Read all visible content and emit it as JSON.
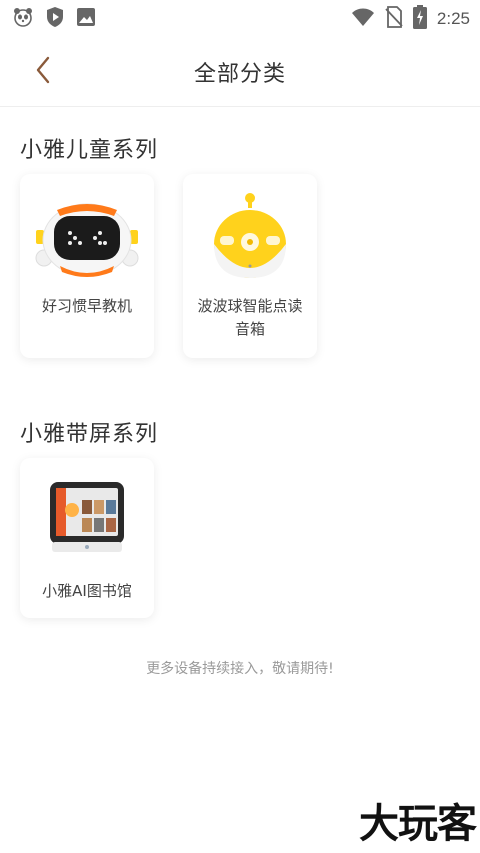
{
  "status_bar": {
    "time": "2:25",
    "icons": [
      "panda-icon",
      "play-protect-icon",
      "image-icon",
      "wifi-icon",
      "no-sim-icon",
      "battery-charging-icon"
    ]
  },
  "header": {
    "title": "全部分类",
    "back_icon": "chevron-left-icon"
  },
  "sections": [
    {
      "title": "小雅儿童系列",
      "cards": [
        {
          "label": "好习惯早教机",
          "icon": "robot-speaker-image"
        },
        {
          "label": "波波球智能点读音箱",
          "icon": "yellow-ball-speaker-image"
        }
      ]
    },
    {
      "title": "小雅带屏系列",
      "cards": [
        {
          "label": "小雅AI图书馆",
          "icon": "screen-device-image"
        }
      ]
    }
  ],
  "footer_note": "更多设备持续接入，敬请期待!",
  "watermark": "大玩客",
  "colors": {
    "accent": "#ff7a1a",
    "yellow": "#ffd21c",
    "text": "#333333",
    "muted": "#9a9a9a"
  }
}
